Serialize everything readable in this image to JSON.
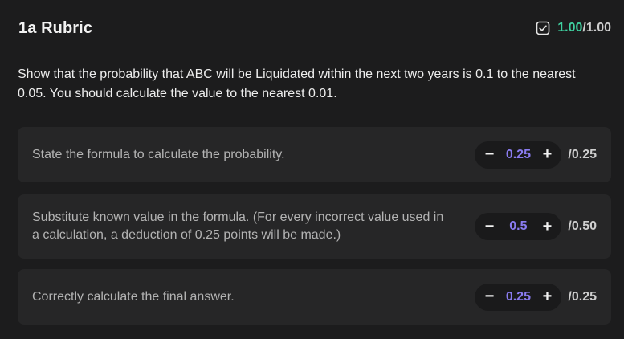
{
  "rubric": {
    "title": "1a Rubric",
    "score": "1.00",
    "separator": "/",
    "max": "1.00",
    "score_color": "#3fd0a0",
    "status_icon": "checkbox-check-icon"
  },
  "question": {
    "text": "Show that the probability that ABC will be Liquidated within the next two years is 0.1 to the nearest 0.05. You should calculate the value to the nearest 0.01."
  },
  "criteria": [
    {
      "text": "State the formula to calculate the probability.",
      "minus": "−",
      "value": "0.25",
      "plus": "+",
      "max": "/0.25"
    },
    {
      "text": "Substitute known value in the formula. (For every incorrect value used in a calculation, a deduction of 0.25 points will be made.)",
      "minus": "−",
      "value": "0.5",
      "plus": "+",
      "max": "/0.50"
    },
    {
      "text": "Correctly calculate the final answer.",
      "minus": "−",
      "value": "0.25",
      "plus": "+",
      "max": "/0.25"
    }
  ]
}
